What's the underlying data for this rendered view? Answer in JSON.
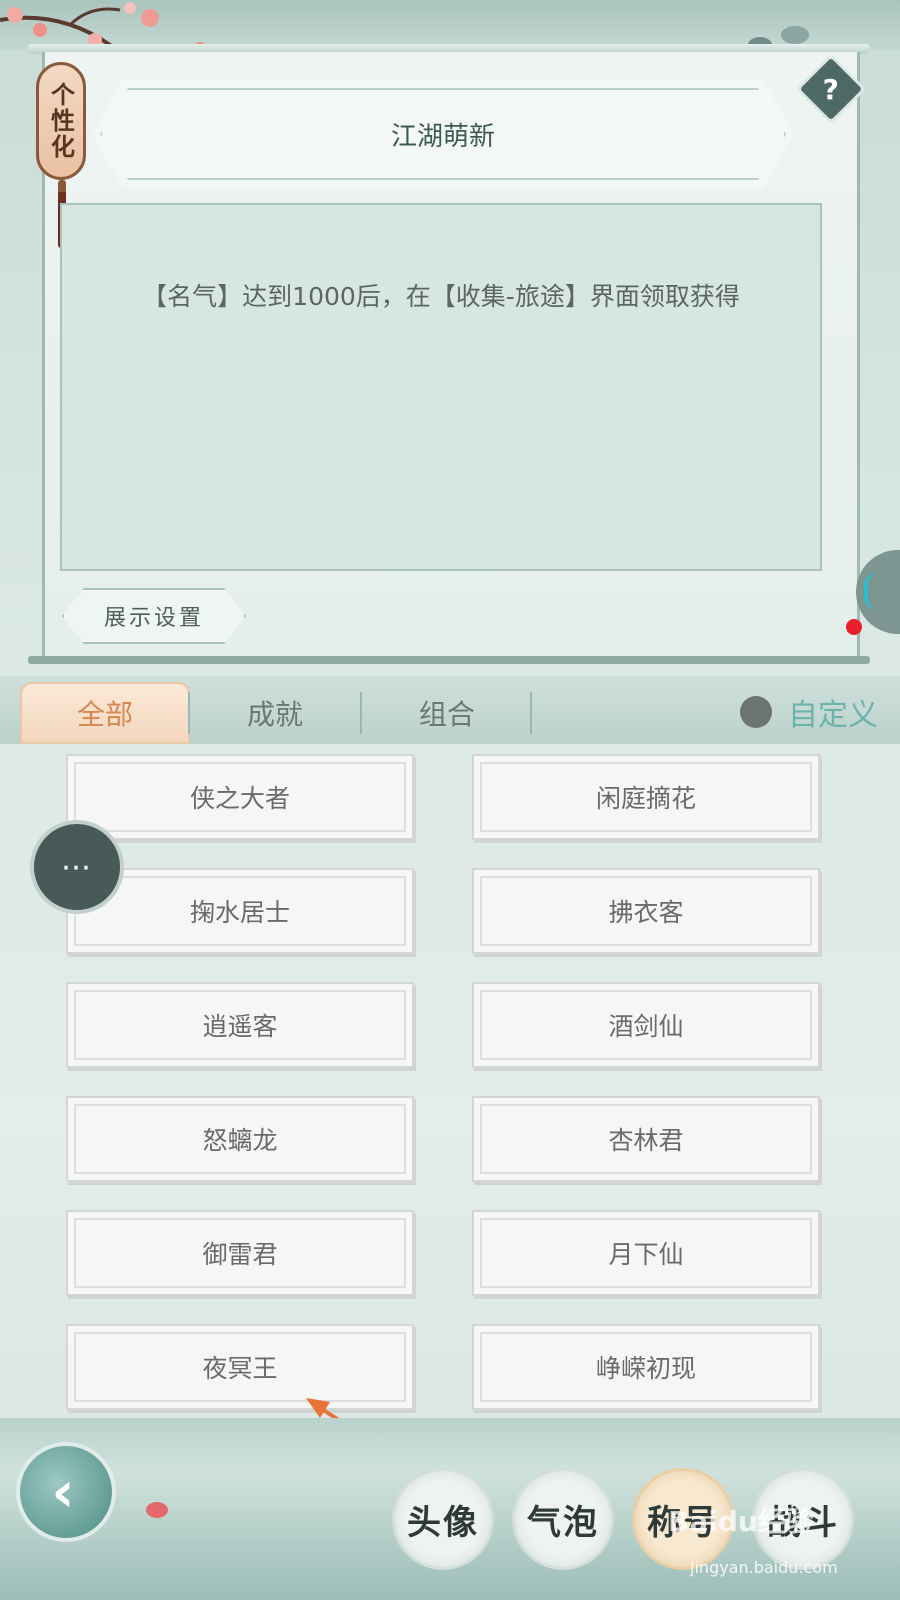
{
  "tag_label": "个性化",
  "help_label": "?",
  "selected_title": "江湖萌新",
  "description": "【名气】达到1000后，在【收集-旅途】界面领取获得",
  "display_settings_label": "展示设置",
  "tabs": [
    {
      "label": "全部",
      "active": true
    },
    {
      "label": "成就",
      "active": false
    },
    {
      "label": "组合",
      "active": false
    }
  ],
  "custom_label": "自定义",
  "titles": [
    "侠之大者",
    "闲庭摘花",
    "掬水居士",
    "拂衣客",
    "逍遥客",
    "酒剑仙",
    "怒螭龙",
    "杏林君",
    "御雷君",
    "月下仙",
    "夜冥王",
    "峥嵘初现"
  ],
  "chat_icon": "chat-bubble-icon",
  "back_icon": "back-arrow-icon",
  "bottom_nav": [
    {
      "label": "头像",
      "active": false
    },
    {
      "label": "气泡",
      "active": false
    },
    {
      "label": "称号",
      "active": true
    },
    {
      "label": "战斗",
      "active": false
    }
  ],
  "watermark": "Baidu经验",
  "watermark_url": "jingyan.baidu.com",
  "colors": {
    "accent_tab": "#d68750",
    "custom_text": "#6bb4ac",
    "annotation_arrow": "#e8743a"
  }
}
